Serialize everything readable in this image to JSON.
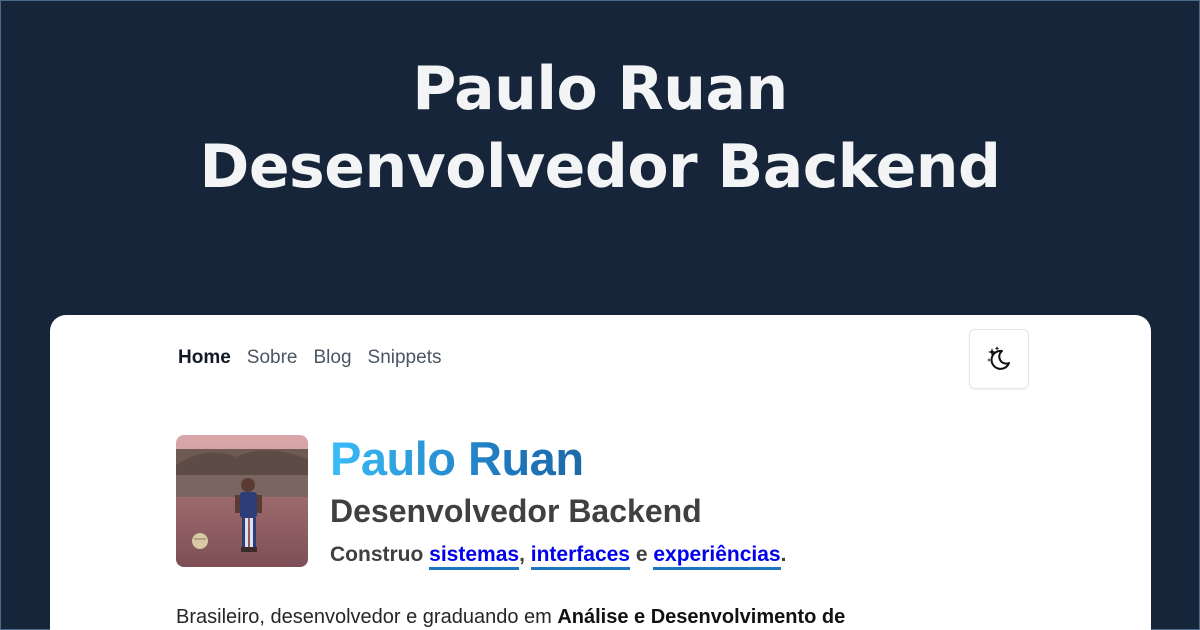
{
  "hero": {
    "line1": "Paulo Ruan",
    "line2": "Desenvolvedor Backend"
  },
  "nav": {
    "items": [
      "Home",
      "Sobre",
      "Blog",
      "Snippets"
    ],
    "active": "Home"
  },
  "theme_toggle": {
    "icon": "moon-stars-icon"
  },
  "profile": {
    "name": "Paulo Ruan",
    "role": "Desenvolvedor Backend",
    "tagline_prefix": "Construo",
    "tagline_word1": "sistemas",
    "tagline_sep1": ",",
    "tagline_word2": "interfaces",
    "tagline_sep2": "e",
    "tagline_word3": "experiências",
    "tagline_end": ".",
    "avatar_alt": "child-photo"
  },
  "bio": {
    "text": "Brasileiro, desenvolvedor e graduando em",
    "emphasis": "Análise e Desenvolvimento de"
  },
  "colors": {
    "background": "#17253a",
    "card": "#ffffff",
    "accent_start": "#38bdf8",
    "accent_end": "#1f77bd"
  }
}
